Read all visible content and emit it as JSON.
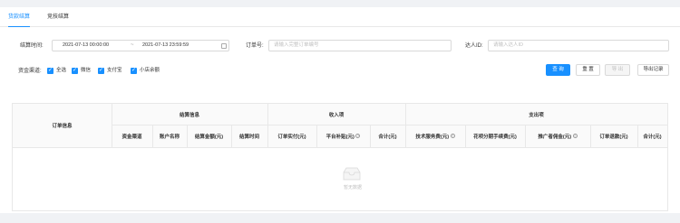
{
  "tabs": [
    {
      "label": "货款结算",
      "active": true
    },
    {
      "label": "竞技结算",
      "active": false
    }
  ],
  "filters": {
    "settle_time_label": "结算时间:",
    "date_start": "2021-07-13 00:00:00",
    "date_sep": "~",
    "date_end": "2021-07-13 23:59:59",
    "order_label": "订单号:",
    "order_placeholder": "请输入完整订单编号",
    "talent_label": "达人ID:",
    "talent_placeholder": "请输入达人ID",
    "channel_label": "资金渠道:",
    "channels": [
      {
        "label": "全选",
        "checked": true
      },
      {
        "label": "微信",
        "checked": true
      },
      {
        "label": "支付宝",
        "checked": true
      },
      {
        "label": "小店余额",
        "checked": true
      }
    ]
  },
  "actions": {
    "query": "查 询",
    "reset": "重 置",
    "export": "导 出",
    "export_log": "导出记录"
  },
  "table": {
    "order_info": "订单信息",
    "groups": {
      "settle": "结算信息",
      "income": "收入项",
      "expense": "支出项"
    },
    "columns": {
      "channel": "资金渠道",
      "account": "账户名称",
      "amount": "结算金额(元)",
      "time": "结算时间",
      "order_paid": "订单实付(元)",
      "platform_subsidy": "平台补贴(元)",
      "income_total": "合计(元)",
      "tech_fee": "技术服务费(元)",
      "installment_fee": "花呗分期手续费(元)",
      "commission": "推广者佣金(元)",
      "refund": "订单退款(元)",
      "expense_total": "合计(元)"
    },
    "empty_text": "暂无数据"
  },
  "colors": {
    "accent": "#1890ff",
    "border": "#e8e8e8",
    "background": "#f0f2f5"
  }
}
